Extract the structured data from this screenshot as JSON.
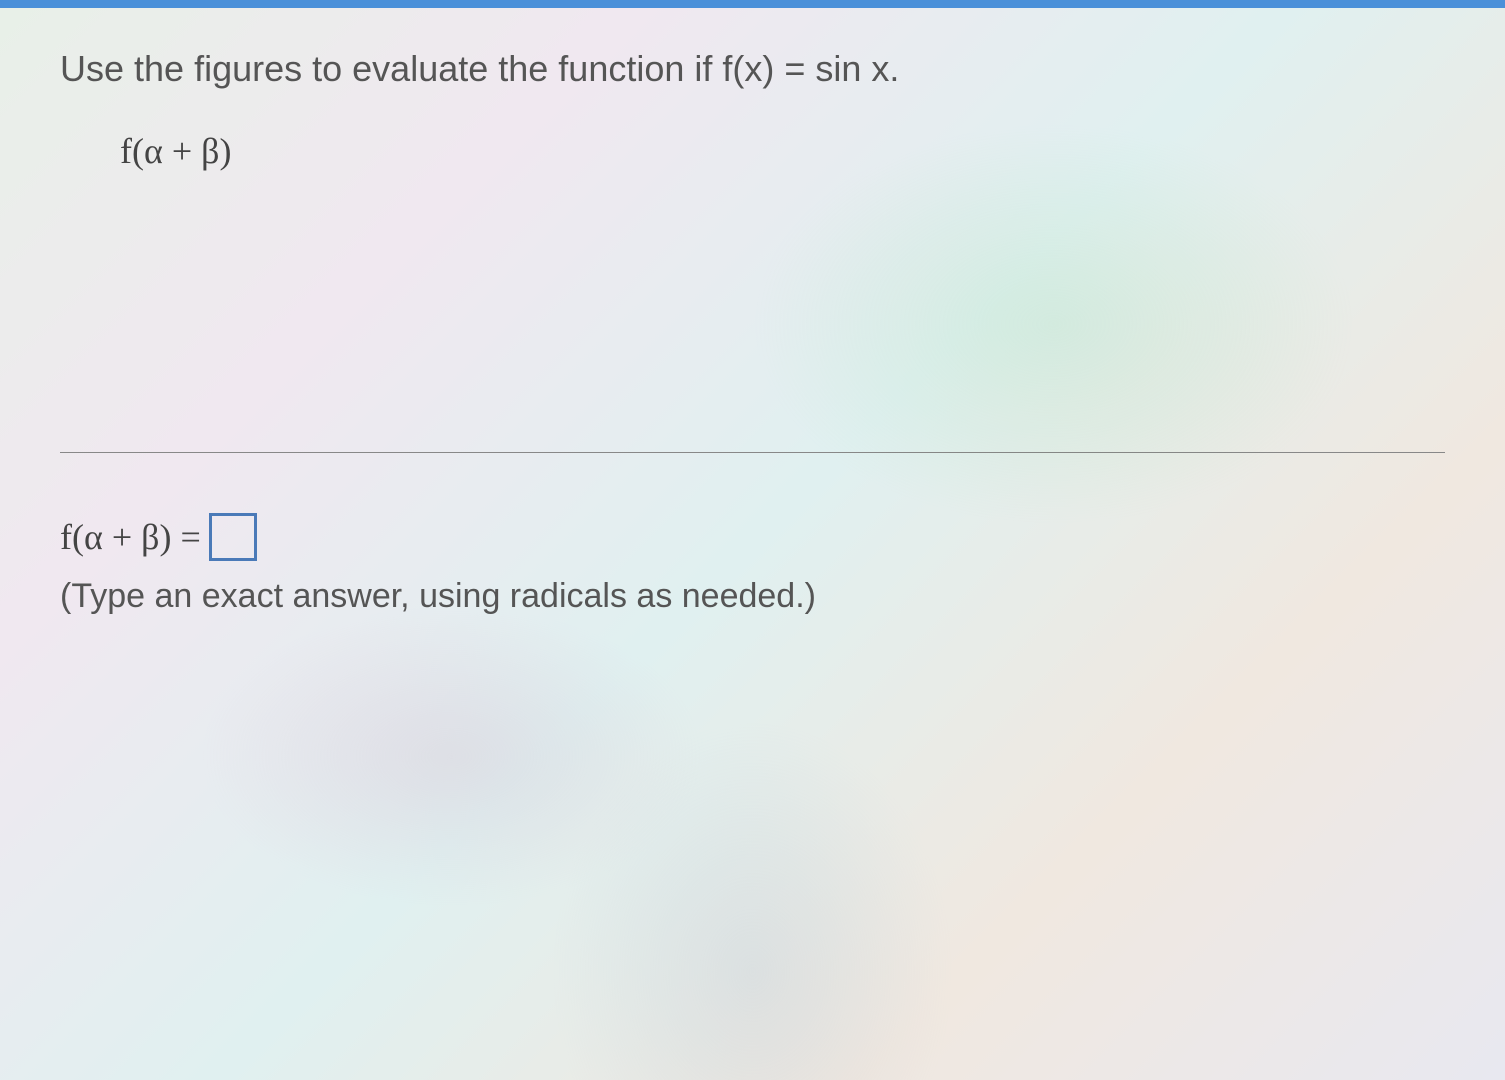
{
  "question": {
    "prompt": "Use the figures to evaluate the function if f(x) = sin x.",
    "expression": "f(α + β)"
  },
  "answer": {
    "lhs": "f(α + β) =",
    "input_value": "",
    "hint": "(Type an exact answer, using radicals as needed.)"
  }
}
